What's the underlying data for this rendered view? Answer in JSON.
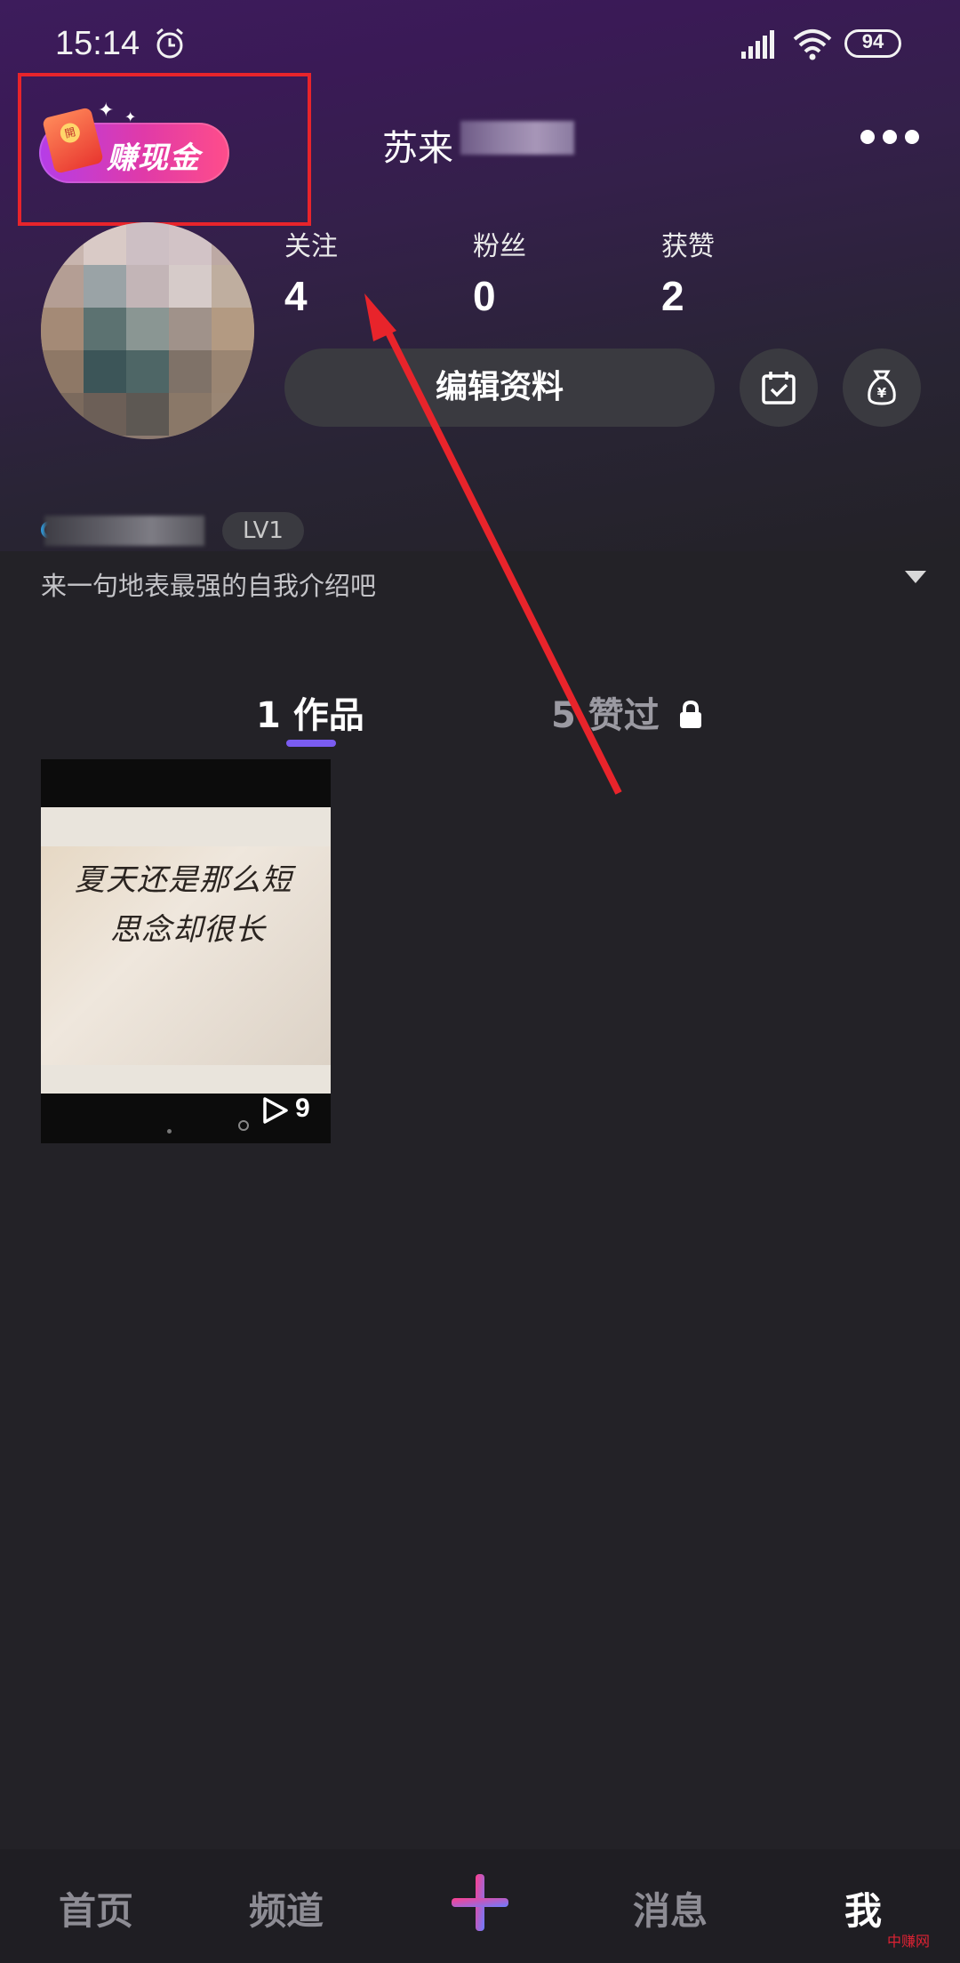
{
  "status_bar": {
    "time": "15:14",
    "battery": "94",
    "icons": [
      "alarm-icon",
      "signal-icon",
      "wifi-icon",
      "battery-icon"
    ]
  },
  "header": {
    "earn_cash_label": "赚现金",
    "username": "苏来",
    "more_icon": "more-icon"
  },
  "profile": {
    "stats": [
      {
        "label": "关注",
        "value": "4"
      },
      {
        "label": "粉丝",
        "value": "0"
      },
      {
        "label": "获赞",
        "value": "2"
      }
    ],
    "edit_button": "编辑资料",
    "level": "LV1",
    "bio_placeholder": "来一句地表最强的自我介绍吧"
  },
  "tabs": [
    {
      "label": "1 作品",
      "active": true
    },
    {
      "label": "5 赞过",
      "locked": true
    }
  ],
  "works": [
    {
      "caption_line1": "夏天还是那么短",
      "caption_line2": "思念却很长",
      "play_count": "9"
    }
  ],
  "bottom_nav": {
    "items": [
      {
        "label": "首页"
      },
      {
        "label": "频道"
      },
      {
        "label": "消息"
      },
      {
        "label": "我",
        "active": true
      }
    ]
  },
  "watermark": "中赚网",
  "colors": {
    "accent_purple": "#7a5cf0",
    "annotation_red": "#e8242b",
    "background": "#232227"
  }
}
